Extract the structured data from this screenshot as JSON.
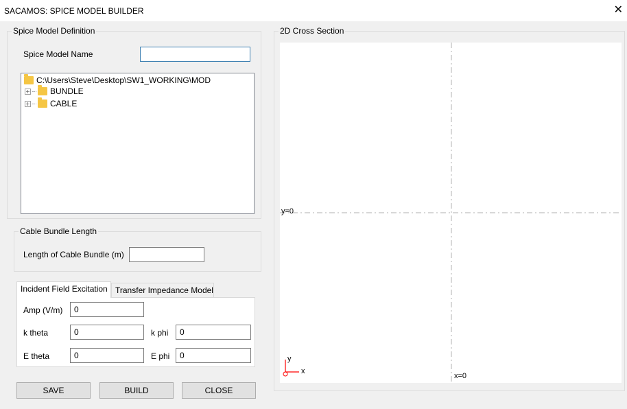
{
  "window": {
    "title": "SACAMOS: SPICE MODEL BUILDER",
    "close_glyph": "✕"
  },
  "definition": {
    "group_title": "Spice Model Definition",
    "name_label": "Spice Model Name",
    "name_value": "",
    "tree": {
      "root": "C:\\Users\\Steve\\Desktop\\SW1_WORKING\\MOD",
      "children": [
        "BUNDLE",
        "CABLE"
      ]
    }
  },
  "bundle_length": {
    "group_title": "Cable Bundle Length",
    "label": "Length of Cable Bundle (m)",
    "value": ""
  },
  "tabs": {
    "incident": "Incident Field Excitation",
    "transfer": "Transfer Impedance Model"
  },
  "excitation": {
    "amp_label": "Amp (V/m)",
    "amp_value": "0",
    "ktheta_label": "k theta",
    "ktheta_value": "0",
    "kphi_label": "k phi",
    "kphi_value": "0",
    "etheta_label": "E theta",
    "etheta_value": "0",
    "ephi_label": "E phi",
    "ephi_value": "0"
  },
  "buttons": {
    "save": "SAVE",
    "build": "BUILD",
    "close": "CLOSE"
  },
  "cross_section": {
    "group_title": "2D Cross Section",
    "y0_label": "y=0",
    "x0_label": "x=0",
    "axis_y": "y",
    "axis_x": "x",
    "axis_color": "#ff0000"
  }
}
